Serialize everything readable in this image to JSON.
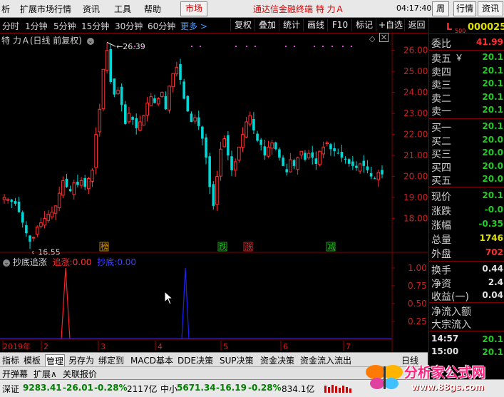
{
  "menu": {
    "items": [
      "析",
      "扩展市场行情",
      "资讯",
      "工具",
      "帮助"
    ],
    "market_tab": "市场",
    "app_title": "通达信金融终端 特 力Ａ",
    "clock": "04:17:40",
    "wd_button": "周三",
    "quote_button": "行情",
    "news_button": "资讯"
  },
  "periods": [
    "分时",
    "1分钟",
    "5分钟",
    "15分钟",
    "30分钟",
    "60分钟"
  ],
  "more_label": "更多 >",
  "toolbar": [
    "复权",
    "叠加",
    "统计",
    "画线",
    "F10",
    "标记",
    "+自选",
    "返回"
  ],
  "chart": {
    "title": "特 力Ａ(日线 前复权)",
    "high_label": "26.39",
    "low_label": "16.55",
    "price_ticks": [
      "26.00",
      "25.00",
      "24.00",
      "23.00",
      "22.00",
      "21.00",
      "20.00",
      "19.00",
      "18.00"
    ],
    "events": [
      {
        "text": "榜",
        "color": "#e0a000"
      },
      {
        "text": "跌",
        "color": "#22cc22"
      },
      {
        "text": "涨",
        "color": "#ff3030"
      },
      {
        "text": "减",
        "color": "#22cc22"
      }
    ]
  },
  "indicator": {
    "name": "抄底追涨",
    "s1_label": "追涨:",
    "s1_value": "0.00",
    "s2_label": "抄底:",
    "s2_value": "0.00",
    "ticks": [
      "1.00",
      "0.75",
      "0.50",
      "0.25"
    ],
    "x_labels": [
      "2019年",
      "2",
      "3",
      "4",
      "5",
      "6",
      "7"
    ],
    "period": "日线"
  },
  "chart_data": {
    "type": "candlestick",
    "title": "特 力Ａ(日线 前复权)",
    "ylim": [
      17.0,
      26.5
    ],
    "high": 26.39,
    "low": 16.55,
    "closes": [
      19.0,
      18.9,
      18.8,
      18.7,
      18.3,
      17.8,
      17.3,
      16.9,
      17.1,
      17.6,
      17.8,
      18.0,
      18.2,
      18.3,
      18.6,
      19.2,
      19.8,
      19.5,
      19.3,
      19.7,
      19.6,
      19.8,
      19.5,
      19.9,
      20.3,
      22.0,
      23.2,
      25.1,
      26.0,
      24.5,
      23.9,
      24.1,
      23.4,
      22.5,
      23.0,
      22.7,
      22.3,
      22.6,
      22.9,
      23.5,
      23.8,
      23.5,
      23.7,
      24.0,
      23.2,
      24.3,
      24.9,
      25.2,
      24.6,
      23.7,
      23.1,
      22.6,
      22.8,
      22.4,
      21.8,
      20.9,
      19.5,
      18.6,
      20.0,
      21.3,
      21.8,
      21.0,
      20.3,
      20.7,
      21.4,
      22.0,
      22.6,
      22.9,
      22.2,
      21.7,
      21.5,
      21.0,
      21.4,
      21.6,
      21.3,
      20.9,
      20.5,
      20.2,
      20.8,
      20.5,
      20.9,
      21.2,
      20.8,
      21.1,
      20.9,
      20.6,
      21.2,
      21.4,
      21.6,
      21.3,
      21.2,
      21.1,
      20.9,
      20.8,
      20.6,
      20.5,
      20.4,
      20.6,
      20.5,
      20.3,
      20.0,
      19.9,
      20.2,
      20.1
    ],
    "signals": {
      "追涨": [
        {
          "x": "2019-02",
          "value": 1.0
        }
      ],
      "抄底": [
        {
          "x": "2019-04",
          "value": 1.0
        }
      ]
    }
  },
  "bottom_tabs": [
    "指标",
    "模板",
    "管理",
    "另存为",
    "绑定到",
    "MACD基本",
    "DDE决策",
    "SUP决策",
    "资金决策",
    "资金流入流出"
  ],
  "bottom_tabs2": [
    "开弹幕",
    "扩展∧",
    "关联报价"
  ],
  "status": {
    "sz_label": "深证",
    "sz_value": "9283.41",
    "sz_change": "-26.01",
    "sz_pct": "-0.28%",
    "sz_amount": "2117亿",
    "zx_label": "中小",
    "zx_value": "5671.34",
    "zx_change": "-16.19",
    "zx_pct": "-0.28%",
    "zx_amount": "834.1亿"
  },
  "quote": {
    "code_prefix": "L",
    "code_sub": "500",
    "code": "000025",
    "weibi_label": "委比",
    "weibi_value": "41.99",
    "asks": [
      {
        "label": "卖五",
        "value": "20.1"
      },
      {
        "label": "卖四",
        "value": "20.1"
      },
      {
        "label": "卖三",
        "value": "20.1"
      },
      {
        "label": "卖二",
        "value": "20.1"
      },
      {
        "label": "卖一",
        "value": "20.1"
      }
    ],
    "ask_mark": "￥",
    "bids": [
      {
        "label": "买一",
        "value": "20.1"
      },
      {
        "label": "买二",
        "value": "20.0"
      },
      {
        "label": "买三",
        "value": "20.0"
      },
      {
        "label": "买四",
        "value": "20.0"
      },
      {
        "label": "买五",
        "value": "20.0"
      }
    ],
    "stats": [
      {
        "label": "现价",
        "value": "20.1",
        "color": "#22cc22"
      },
      {
        "label": "涨跌",
        "value": "-0.0",
        "color": "#22cc22"
      },
      {
        "label": "涨幅",
        "value": "-0.35",
        "color": "#22cc22"
      },
      {
        "label": "总量",
        "value": "1746",
        "color": "#e0e000"
      },
      {
        "label": "外盘",
        "value": "702",
        "color": "#ff3030"
      }
    ],
    "stats2": [
      {
        "label": "换手",
        "value": "0.44",
        "color": "#e0e0e0"
      },
      {
        "label": "净资",
        "value": "2.4",
        "color": "#e0e0e0"
      },
      {
        "label": "收益(一)",
        "value": "0.04",
        "color": "#e0e0e0"
      }
    ],
    "flow1": "净流入额",
    "flow2": "大宗流入",
    "ticks": [
      {
        "time": "14:57",
        "value": "20.1"
      },
      {
        "time": "15:00",
        "value": "20.1"
      }
    ]
  },
  "watermark": {
    "text1": "分析家公式网",
    "text2": "www.88gs.com"
  },
  "colors": {
    "up": "#ff3030",
    "down": "#00d8d8",
    "border": "#7f0000"
  }
}
